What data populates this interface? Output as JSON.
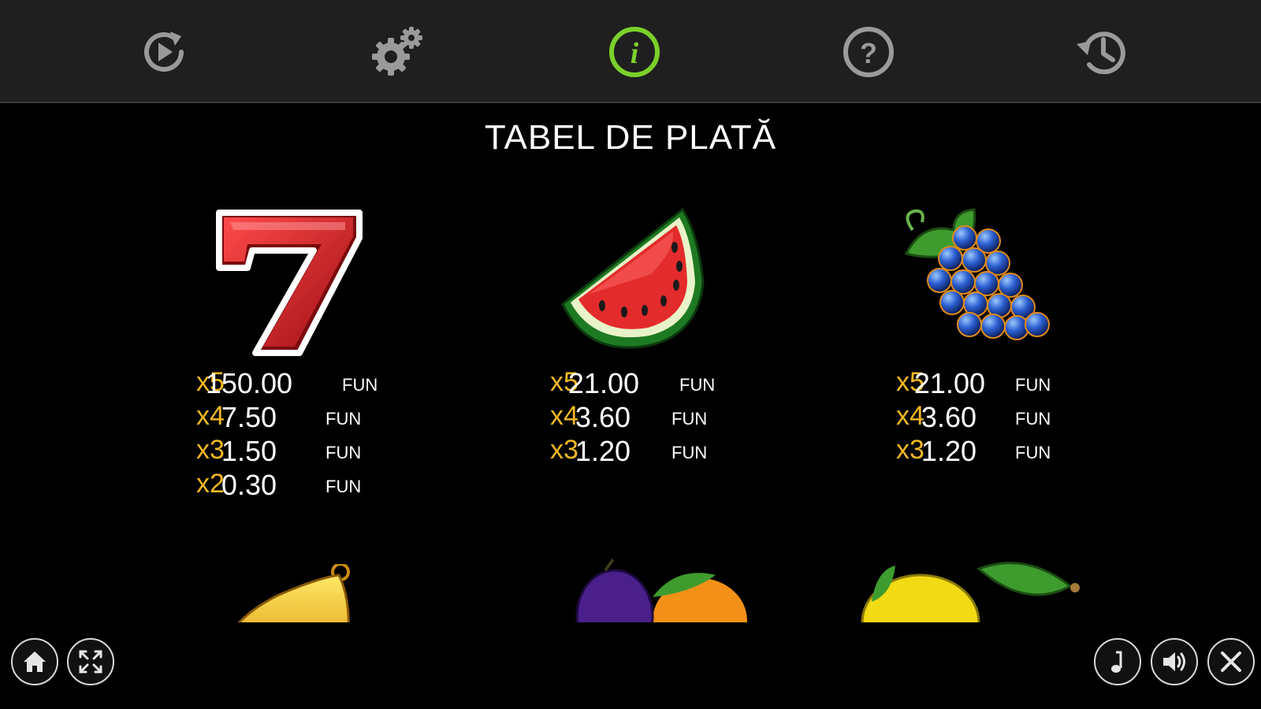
{
  "toolbar": {
    "items": [
      {
        "icon": "autoplay-icon",
        "active": false
      },
      {
        "icon": "settings-icon",
        "active": false
      },
      {
        "icon": "info-icon",
        "active": true
      },
      {
        "icon": "help-icon",
        "active": false
      },
      {
        "icon": "history-icon",
        "active": false
      }
    ],
    "active_color": "#7bd02a",
    "icon_color": "#9a9a9a"
  },
  "page": {
    "title": "TABEL DE PLATĂ"
  },
  "paytable": {
    "currency": "FUN",
    "symbols": [
      {
        "icon": "seven-symbol-icon",
        "rows": [
          {
            "mult": "x5",
            "amount": "150.00"
          },
          {
            "mult": "x4",
            "amount": "7.50"
          },
          {
            "mult": "x3",
            "amount": "1.50"
          },
          {
            "mult": "x2",
            "amount": "0.30"
          }
        ]
      },
      {
        "icon": "watermelon-symbol-icon",
        "rows": [
          {
            "mult": "x5",
            "amount": "21.00"
          },
          {
            "mult": "x4",
            "amount": "3.60"
          },
          {
            "mult": "x3",
            "amount": "1.20"
          }
        ]
      },
      {
        "icon": "grapes-symbol-icon",
        "rows": [
          {
            "mult": "x5",
            "amount": "21.00"
          },
          {
            "mult": "x4",
            "amount": "3.60"
          },
          {
            "mult": "x3",
            "amount": "1.20"
          }
        ]
      }
    ],
    "partial_symbols": [
      "bell-symbol-icon",
      "plum-orange-symbol-icon",
      "lemon-symbol-icon"
    ]
  },
  "bottom_controls": {
    "left": [
      "home-icon",
      "fullscreen-icon"
    ],
    "right": [
      "music-icon",
      "sound-icon",
      "close-icon"
    ]
  },
  "colors": {
    "multiplier": "#f2b822",
    "background": "#000000",
    "toolbar": "#1f1f1f"
  }
}
